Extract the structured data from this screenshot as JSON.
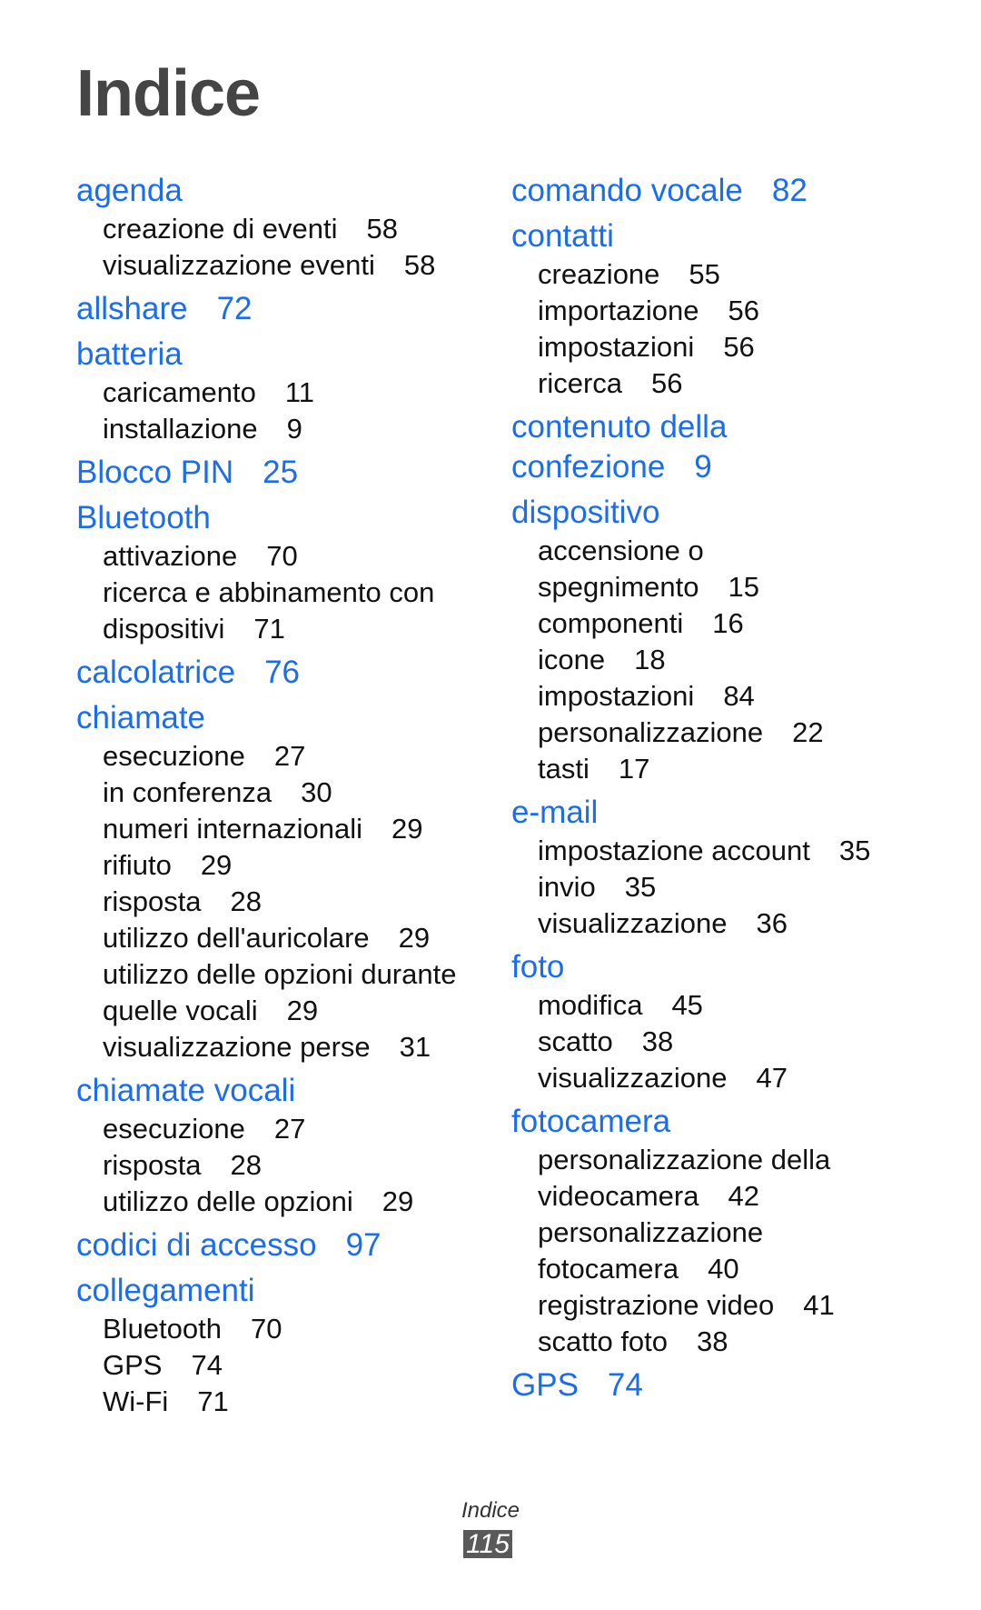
{
  "title": "Indice",
  "colors": {
    "heading": "#1a6cf0",
    "text": "#111111",
    "title": "#454545"
  },
  "columns": [
    [
      {
        "heading": "agenda",
        "page": "",
        "subs": [
          {
            "text": "creazione di eventi",
            "page": "58"
          },
          {
            "text": "visualizzazione eventi",
            "page": "58"
          }
        ]
      },
      {
        "heading": "allshare",
        "page": "72",
        "subs": []
      },
      {
        "heading": "batteria",
        "page": "",
        "subs": [
          {
            "text": "caricamento",
            "page": "11"
          },
          {
            "text": "installazione",
            "page": "9"
          }
        ]
      },
      {
        "heading": "Blocco PIN",
        "page": "25",
        "subs": []
      },
      {
        "heading": "Bluetooth",
        "page": "",
        "subs": [
          {
            "text": "attivazione",
            "page": "70"
          },
          {
            "text": "ricerca e abbinamento con\ndispositivi",
            "page": "71"
          }
        ]
      },
      {
        "heading": "calcolatrice",
        "page": "76",
        "subs": []
      },
      {
        "heading": "chiamate",
        "page": "",
        "subs": [
          {
            "text": "esecuzione",
            "page": "27"
          },
          {
            "text": "in conferenza",
            "page": "30"
          },
          {
            "text": "numeri internazionali",
            "page": "29"
          },
          {
            "text": "rifiuto",
            "page": "29"
          },
          {
            "text": "risposta",
            "page": "28"
          },
          {
            "text": "utilizzo dell'auricolare",
            "page": "29"
          },
          {
            "text": "utilizzo delle opzioni durante\nquelle vocali",
            "page": "29"
          },
          {
            "text": "visualizzazione perse",
            "page": "31"
          }
        ]
      },
      {
        "heading": "chiamate vocali",
        "page": "",
        "subs": [
          {
            "text": "esecuzione",
            "page": "27"
          },
          {
            "text": "risposta",
            "page": "28"
          },
          {
            "text": "utilizzo delle opzioni",
            "page": "29"
          }
        ]
      },
      {
        "heading": "codici di accesso",
        "page": "97",
        "subs": []
      },
      {
        "heading": "collegamenti",
        "page": "",
        "subs": [
          {
            "text": "Bluetooth",
            "page": "70"
          },
          {
            "text": "GPS",
            "page": "74"
          },
          {
            "text": "Wi-Fi",
            "page": "71"
          }
        ]
      }
    ],
    [
      {
        "heading": "comando vocale",
        "page": "82",
        "subs": []
      },
      {
        "heading": "contatti",
        "page": "",
        "subs": [
          {
            "text": "creazione",
            "page": "55"
          },
          {
            "text": "importazione",
            "page": "56"
          },
          {
            "text": "impostazioni",
            "page": "56"
          },
          {
            "text": "ricerca",
            "page": "56"
          }
        ]
      },
      {
        "heading": "contenuto della\nconfezione",
        "page": "9",
        "subs": []
      },
      {
        "heading": "dispositivo",
        "page": "",
        "subs": [
          {
            "text": "accensione o\nspegnimento",
            "page": "15"
          },
          {
            "text": "componenti",
            "page": "16"
          },
          {
            "text": "icone",
            "page": "18"
          },
          {
            "text": "impostazioni",
            "page": "84"
          },
          {
            "text": "personalizzazione",
            "page": "22"
          },
          {
            "text": "tasti",
            "page": "17"
          }
        ]
      },
      {
        "heading": "e-mail",
        "page": "",
        "subs": [
          {
            "text": "impostazione account",
            "page": "35"
          },
          {
            "text": "invio",
            "page": "35"
          },
          {
            "text": "visualizzazione",
            "page": "36"
          }
        ]
      },
      {
        "heading": "foto",
        "page": "",
        "subs": [
          {
            "text": "modifica",
            "page": "45"
          },
          {
            "text": "scatto",
            "page": "38"
          },
          {
            "text": "visualizzazione",
            "page": "47"
          }
        ]
      },
      {
        "heading": "fotocamera",
        "page": "",
        "subs": [
          {
            "text": "personalizzazione della\nvideocamera",
            "page": "42"
          },
          {
            "text": "personalizzazione\nfotocamera",
            "page": "40"
          },
          {
            "text": "registrazione video",
            "page": "41"
          },
          {
            "text": "scatto foto",
            "page": "38"
          }
        ]
      },
      {
        "heading": "GPS",
        "page": "74",
        "subs": []
      }
    ]
  ],
  "footer": {
    "section": "Indice",
    "page_number": "115"
  }
}
